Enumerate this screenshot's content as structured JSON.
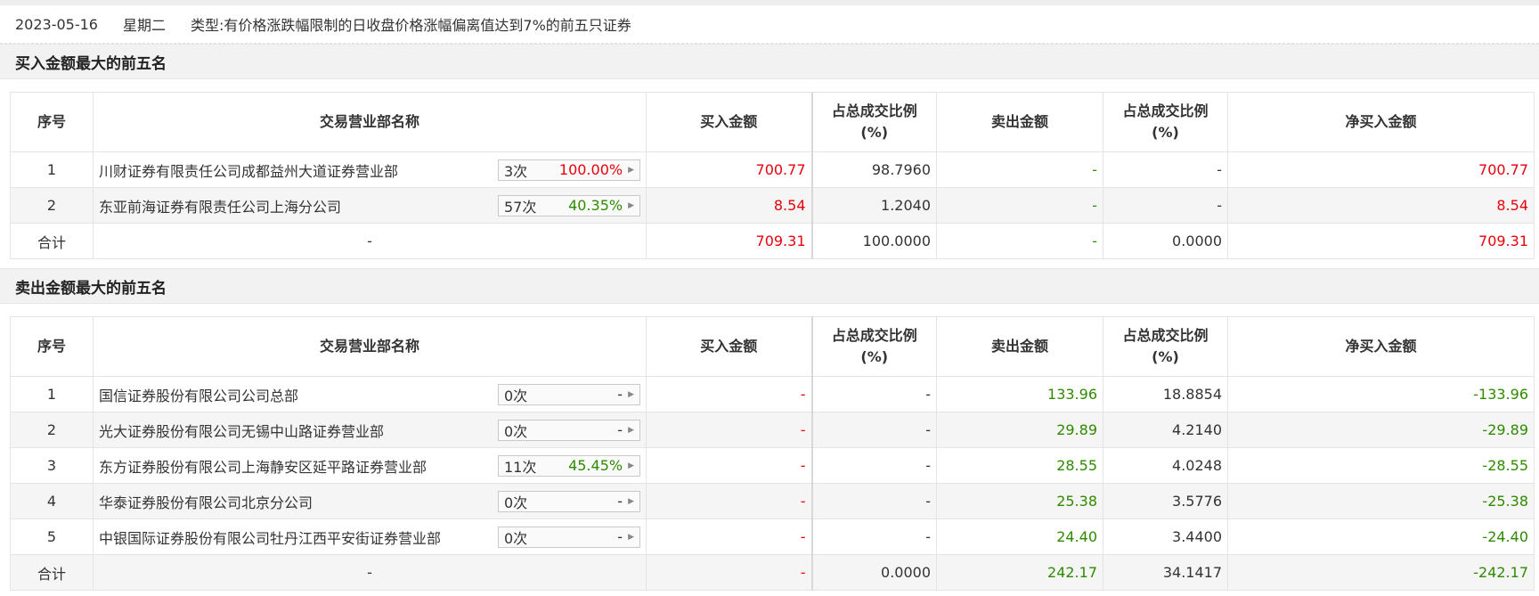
{
  "info": {
    "date": "2023-05-16",
    "weekday": "星期二",
    "type_label": "类型:",
    "type_value": "有价格涨跌幅限制的日收盘价格涨幅偏离值达到7%的前五只证券"
  },
  "colors": {
    "up": "#e8000b",
    "down": "#2e8b00",
    "neutral": "#333333"
  },
  "headers": {
    "seq": "序号",
    "name": "交易营业部名称",
    "buy": "买入金额",
    "ratio_line1": "占总成交比例",
    "ratio_line2": "(%)",
    "sell": "卖出金额",
    "net": "净买入金额"
  },
  "buy_section": {
    "title": "买入金额最大的前五名",
    "rows": [
      {
        "seq": "1",
        "name": "川财证券有限责任公司成都益州大道证券营业部",
        "times": "3次",
        "rate": "100.00%",
        "buy": "700.77",
        "buy_ratio": "98.7960",
        "sell": "-",
        "sell_ratio": "-",
        "net": "700.77"
      },
      {
        "seq": "2",
        "name": "东亚前海证券有限责任公司上海分公司",
        "times": "57次",
        "rate": "40.35%",
        "buy": "8.54",
        "buy_ratio": "1.2040",
        "sell": "-",
        "sell_ratio": "-",
        "net": "8.54"
      }
    ],
    "total": {
      "label": "合计",
      "name": "-",
      "buy": "709.31",
      "buy_ratio": "100.0000",
      "sell": "-",
      "sell_ratio": "0.0000",
      "net": "709.31"
    }
  },
  "sell_section": {
    "title": "卖出金额最大的前五名",
    "rows": [
      {
        "seq": "1",
        "name": "国信证券股份有限公司公司总部",
        "times": "0次",
        "rate": "-",
        "buy": "-",
        "buy_ratio": "-",
        "sell": "133.96",
        "sell_ratio": "18.8854",
        "net": "-133.96"
      },
      {
        "seq": "2",
        "name": "光大证券股份有限公司无锡中山路证券营业部",
        "times": "0次",
        "rate": "-",
        "buy": "-",
        "buy_ratio": "-",
        "sell": "29.89",
        "sell_ratio": "4.2140",
        "net": "-29.89"
      },
      {
        "seq": "3",
        "name": "东方证券股份有限公司上海静安区延平路证券营业部",
        "times": "11次",
        "rate": "45.45%",
        "buy": "-",
        "buy_ratio": "-",
        "sell": "28.55",
        "sell_ratio": "4.0248",
        "net": "-28.55"
      },
      {
        "seq": "4",
        "name": "华泰证券股份有限公司北京分公司",
        "times": "0次",
        "rate": "-",
        "buy": "-",
        "buy_ratio": "-",
        "sell": "25.38",
        "sell_ratio": "3.5776",
        "net": "-25.38"
      },
      {
        "seq": "5",
        "name": "中银国际证券股份有限公司牡丹江西平安街证券营业部",
        "times": "0次",
        "rate": "-",
        "buy": "-",
        "buy_ratio": "-",
        "sell": "24.40",
        "sell_ratio": "3.4400",
        "net": "-24.40"
      }
    ],
    "total": {
      "label": "合计",
      "name": "-",
      "buy": "-",
      "buy_ratio": "0.0000",
      "sell": "242.17",
      "sell_ratio": "34.1417",
      "net": "-242.17"
    }
  }
}
